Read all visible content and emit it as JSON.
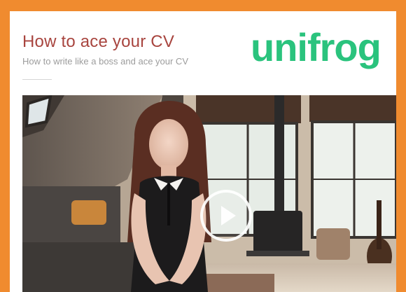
{
  "header": {
    "title": "How to ace your CV",
    "subtitle": "How to write like a boss and ace your CV",
    "logo_text": "unifrog"
  },
  "video": {
    "thumbnail": "presenter-in-living-room",
    "play_icon": "play-icon"
  },
  "colors": {
    "frame": "#f08b2f",
    "title": "#a8453f",
    "logo": "#2ac37d"
  }
}
